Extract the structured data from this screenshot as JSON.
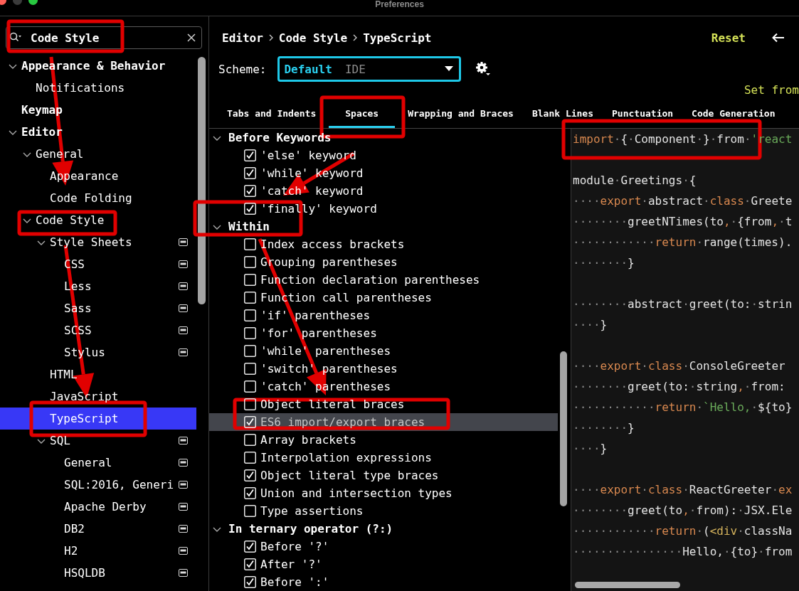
{
  "window": {
    "title": "Preferences"
  },
  "search": {
    "value": "Code Style"
  },
  "tree": [
    {
      "label": "Appearance & Behavior",
      "expanded": true,
      "selected": false,
      "children": [
        {
          "label": "Notifications",
          "selected": false
        }
      ]
    },
    {
      "label": "Keymap",
      "selected": false
    },
    {
      "label": "Editor",
      "expanded": true,
      "selected": false,
      "children": [
        {
          "label": "General",
          "expanded": true,
          "selected": false,
          "children": [
            {
              "label": "Appearance",
              "selected": false
            },
            {
              "label": "Code Folding",
              "selected": false
            }
          ]
        },
        {
          "label": "Code Style",
          "expanded": true,
          "selected": false,
          "children": [
            {
              "label": "Style Sheets",
              "expanded": true,
              "selected": false,
              "project_scheme": true,
              "children": [
                {
                  "label": "CSS",
                  "selected": false,
                  "project_scheme": true
                },
                {
                  "label": "Less",
                  "selected": false,
                  "project_scheme": true
                },
                {
                  "label": "Sass",
                  "selected": false,
                  "project_scheme": true
                },
                {
                  "label": "SCSS",
                  "selected": false,
                  "project_scheme": true
                },
                {
                  "label": "Stylus",
                  "selected": false,
                  "project_scheme": true
                }
              ]
            },
            {
              "label": "HTML",
              "selected": false
            },
            {
              "label": "JavaScript",
              "selected": false
            },
            {
              "label": "TypeScript",
              "selected": true
            },
            {
              "label": "SQL",
              "expanded": true,
              "selected": false,
              "project_scheme": true,
              "children": [
                {
                  "label": "General",
                  "selected": false,
                  "project_scheme": true
                },
                {
                  "label": "SQL:2016, Generi",
                  "selected": false,
                  "project_scheme": true
                },
                {
                  "label": "Apache Derby",
                  "selected": false,
                  "project_scheme": true
                },
                {
                  "label": "DB2",
                  "selected": false,
                  "project_scheme": true
                },
                {
                  "label": "H2",
                  "selected": false,
                  "project_scheme": true
                },
                {
                  "label": "HSQLDB",
                  "selected": false,
                  "project_scheme": true
                }
              ]
            }
          ]
        }
      ]
    }
  ],
  "breadcrumb": [
    "Editor",
    "Code Style",
    "TypeScript"
  ],
  "reset_link": "Reset",
  "scheme": {
    "label": "Scheme:",
    "name": "Default",
    "type": "IDE"
  },
  "set_from_link": "Set from",
  "tabs": [
    {
      "label": "Tabs and Indents",
      "selected": false
    },
    {
      "label": "Spaces",
      "selected": true
    },
    {
      "label": "Wrapping and Braces",
      "selected": false
    },
    {
      "label": "Blank Lines",
      "selected": false
    },
    {
      "label": "Punctuation",
      "selected": false
    },
    {
      "label": "Code Generation",
      "selected": false
    }
  ],
  "option_groups": [
    {
      "title": "Before Keywords",
      "expanded": true,
      "options": [
        {
          "label": "'else' keyword",
          "checked": true,
          "selected": false
        },
        {
          "label": "'while' keyword",
          "checked": true,
          "selected": false
        },
        {
          "label": "'catch' keyword",
          "checked": true,
          "selected": false
        },
        {
          "label": "'finally' keyword",
          "checked": true,
          "selected": false
        }
      ]
    },
    {
      "title": "Within",
      "expanded": true,
      "options": [
        {
          "label": "Index access brackets",
          "checked": false,
          "selected": false
        },
        {
          "label": "Grouping parentheses",
          "checked": false,
          "selected": false
        },
        {
          "label": "Function declaration parentheses",
          "checked": false,
          "selected": false
        },
        {
          "label": "Function call parentheses",
          "checked": false,
          "selected": false
        },
        {
          "label": "'if' parentheses",
          "checked": false,
          "selected": false
        },
        {
          "label": "'for' parentheses",
          "checked": false,
          "selected": false
        },
        {
          "label": "'while' parentheses",
          "checked": false,
          "selected": false
        },
        {
          "label": "'switch' parentheses",
          "checked": false,
          "selected": false
        },
        {
          "label": "'catch' parentheses",
          "checked": false,
          "selected": false
        },
        {
          "label": "Object literal braces",
          "checked": false,
          "selected": false
        },
        {
          "label": "ES6 import/export braces",
          "checked": true,
          "selected": true
        },
        {
          "label": "Array brackets",
          "checked": false,
          "selected": false
        },
        {
          "label": "Interpolation expressions",
          "checked": false,
          "selected": false
        },
        {
          "label": "Object literal type braces",
          "checked": true,
          "selected": false
        },
        {
          "label": "Union and intersection types",
          "checked": true,
          "selected": false
        },
        {
          "label": "Type assertions",
          "checked": false,
          "selected": false
        }
      ]
    },
    {
      "title": "In ternary operator (?:)",
      "expanded": true,
      "options": [
        {
          "label": "Before '?'",
          "checked": true,
          "selected": false
        },
        {
          "label": "After '?'",
          "checked": true,
          "selected": false
        },
        {
          "label": "Before ':'",
          "checked": true,
          "selected": false
        }
      ]
    }
  ],
  "code_lines": [
    {
      "kind": "code",
      "tokens": [
        {
          "kind": "keyword",
          "text": "import"
        },
        {
          "kind": "space",
          "text": "·"
        },
        {
          "kind": "plain",
          "text": "{"
        },
        {
          "kind": "space",
          "text": "·"
        },
        {
          "kind": "plain",
          "text": "Component"
        },
        {
          "kind": "space",
          "text": "·"
        },
        {
          "kind": "plain",
          "text": "}"
        },
        {
          "kind": "space",
          "text": "·"
        },
        {
          "kind": "plain",
          "text": "from"
        },
        {
          "kind": "space",
          "text": "·"
        },
        {
          "kind": "string",
          "text": "'react"
        }
      ]
    },
    {
      "kind": "blank"
    },
    {
      "kind": "code",
      "tokens": [
        {
          "kind": "plain",
          "text": "module"
        },
        {
          "kind": "space",
          "text": "·"
        },
        {
          "kind": "plain",
          "text": "Greetings"
        },
        {
          "kind": "space",
          "text": "·"
        },
        {
          "kind": "plain",
          "text": "{"
        }
      ]
    },
    {
      "kind": "code",
      "tokens": [
        {
          "kind": "space",
          "text": "····"
        },
        {
          "kind": "keyword",
          "text": "export"
        },
        {
          "kind": "space",
          "text": "·"
        },
        {
          "kind": "plain",
          "text": "abstract"
        },
        {
          "kind": "space",
          "text": "·"
        },
        {
          "kind": "keyword",
          "text": "class"
        },
        {
          "kind": "space",
          "text": "·"
        },
        {
          "kind": "plain",
          "text": "Greete"
        }
      ]
    },
    {
      "kind": "code",
      "tokens": [
        {
          "kind": "space",
          "text": "········"
        },
        {
          "kind": "plain",
          "text": "greetNTimes(to"
        },
        {
          "kind": "keyword",
          "text": ","
        },
        {
          "kind": "space",
          "text": "·"
        },
        {
          "kind": "plain",
          "text": "{from"
        },
        {
          "kind": "keyword",
          "text": ","
        },
        {
          "kind": "space",
          "text": "·"
        },
        {
          "kind": "plain",
          "text": "t"
        }
      ]
    },
    {
      "kind": "code",
      "tokens": [
        {
          "kind": "space",
          "text": "············"
        },
        {
          "kind": "keyword",
          "text": "return"
        },
        {
          "kind": "space",
          "text": "·"
        },
        {
          "kind": "plain",
          "text": "range(times)."
        }
      ]
    },
    {
      "kind": "code",
      "tokens": [
        {
          "kind": "space",
          "text": "········"
        },
        {
          "kind": "plain",
          "text": "}"
        }
      ]
    },
    {
      "kind": "blank"
    },
    {
      "kind": "code",
      "tokens": [
        {
          "kind": "space",
          "text": "········"
        },
        {
          "kind": "plain",
          "text": "abstract"
        },
        {
          "kind": "space",
          "text": "·"
        },
        {
          "kind": "plain",
          "text": "greet(to:"
        },
        {
          "kind": "space",
          "text": "·"
        },
        {
          "kind": "plain",
          "text": "strin"
        }
      ]
    },
    {
      "kind": "code",
      "tokens": [
        {
          "kind": "space",
          "text": "····"
        },
        {
          "kind": "plain",
          "text": "}"
        }
      ]
    },
    {
      "kind": "blank"
    },
    {
      "kind": "code",
      "tokens": [
        {
          "kind": "space",
          "text": "····"
        },
        {
          "kind": "keyword",
          "text": "export"
        },
        {
          "kind": "space",
          "text": "·"
        },
        {
          "kind": "keyword",
          "text": "class"
        },
        {
          "kind": "space",
          "text": "·"
        },
        {
          "kind": "plain",
          "text": "ConsoleGreeter"
        }
      ]
    },
    {
      "kind": "code",
      "tokens": [
        {
          "kind": "space",
          "text": "········"
        },
        {
          "kind": "plain",
          "text": "greet(to:"
        },
        {
          "kind": "space",
          "text": "·"
        },
        {
          "kind": "plain",
          "text": "string"
        },
        {
          "kind": "keyword",
          "text": ","
        },
        {
          "kind": "space",
          "text": "·"
        },
        {
          "kind": "plain",
          "text": "from:"
        }
      ]
    },
    {
      "kind": "code",
      "tokens": [
        {
          "kind": "space",
          "text": "············"
        },
        {
          "kind": "keyword",
          "text": "return"
        },
        {
          "kind": "space",
          "text": "·"
        },
        {
          "kind": "string",
          "text": "`Hello,"
        },
        {
          "kind": "space",
          "text": "·"
        },
        {
          "kind": "plain",
          "text": "${to}"
        }
      ]
    },
    {
      "kind": "code",
      "tokens": [
        {
          "kind": "space",
          "text": "········"
        },
        {
          "kind": "plain",
          "text": "}"
        }
      ]
    },
    {
      "kind": "code",
      "tokens": [
        {
          "kind": "space",
          "text": "····"
        },
        {
          "kind": "plain",
          "text": "}"
        }
      ]
    },
    {
      "kind": "blank"
    },
    {
      "kind": "code",
      "tokens": [
        {
          "kind": "space",
          "text": "····"
        },
        {
          "kind": "keyword",
          "text": "export"
        },
        {
          "kind": "space",
          "text": "·"
        },
        {
          "kind": "keyword",
          "text": "class"
        },
        {
          "kind": "space",
          "text": "·"
        },
        {
          "kind": "plain",
          "text": "ReactGreeter"
        },
        {
          "kind": "space",
          "text": "·"
        },
        {
          "kind": "keyword",
          "text": "ex"
        }
      ]
    },
    {
      "kind": "code",
      "tokens": [
        {
          "kind": "space",
          "text": "········"
        },
        {
          "kind": "plain",
          "text": "greet(to"
        },
        {
          "kind": "keyword",
          "text": ","
        },
        {
          "kind": "space",
          "text": "·"
        },
        {
          "kind": "plain",
          "text": "from):"
        },
        {
          "kind": "space",
          "text": "·"
        },
        {
          "kind": "plain",
          "text": "JSX.Ele"
        }
      ]
    },
    {
      "kind": "code",
      "tokens": [
        {
          "kind": "space",
          "text": "············"
        },
        {
          "kind": "keyword",
          "text": "return"
        },
        {
          "kind": "space",
          "text": "·"
        },
        {
          "kind": "plain",
          "text": "("
        },
        {
          "kind": "tag",
          "text": "<div"
        },
        {
          "kind": "space",
          "text": "·"
        },
        {
          "kind": "plain",
          "text": "classNa"
        }
      ]
    },
    {
      "kind": "code",
      "tokens": [
        {
          "kind": "space",
          "text": "················"
        },
        {
          "kind": "plain",
          "text": "Hello,"
        },
        {
          "kind": "space",
          "text": "·"
        },
        {
          "kind": "plain",
          "text": "{to}"
        },
        {
          "kind": "space",
          "text": "·"
        },
        {
          "kind": "plain",
          "text": "from"
        }
      ]
    }
  ]
}
